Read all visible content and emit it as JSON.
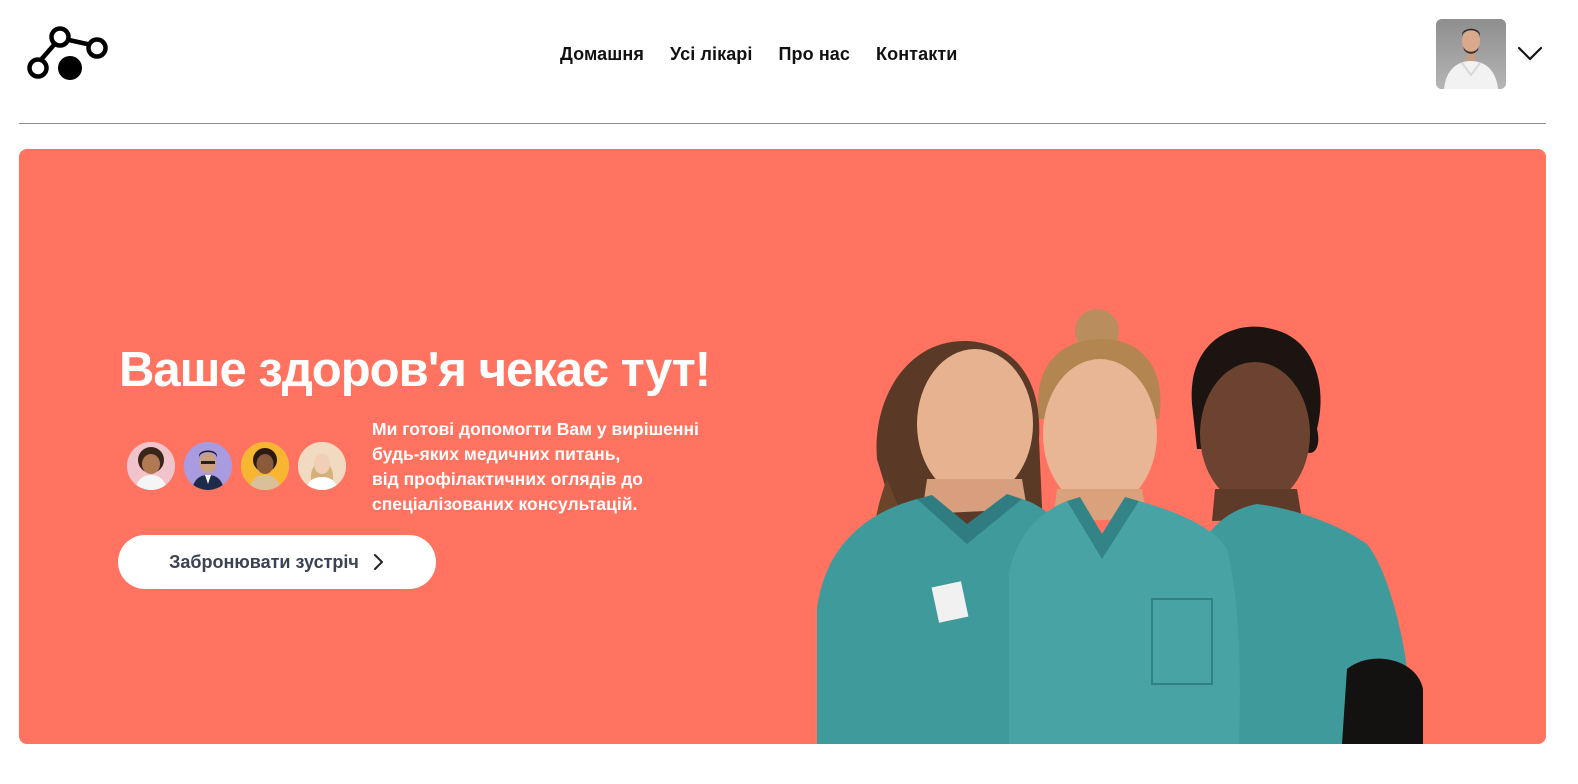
{
  "header": {
    "logo_icon": "nodes-logo-icon",
    "nav": [
      {
        "label": "Домашня"
      },
      {
        "label": "Усі лікарі"
      },
      {
        "label": "Про нас"
      },
      {
        "label": "Контакти"
      }
    ],
    "profile_icon": "user-avatar",
    "menu_icon": "chevron-down-icon"
  },
  "hero": {
    "title": "Ваше здоров'я чекає тут!",
    "description_lines": [
      "Ми готові допомогти Вам у вирішенні",
      "будь-яких медичних питань,",
      "від профілактичних оглядів до",
      "спеціалізованих консультацій."
    ],
    "cta_label": "Забронювати зустріч",
    "cta_icon": "chevron-right-icon"
  },
  "colors": {
    "hero_bg": "#ff7360",
    "text_dark": "#111111",
    "cta_text": "#3b4253",
    "scrubs": "#3f9a9c"
  }
}
